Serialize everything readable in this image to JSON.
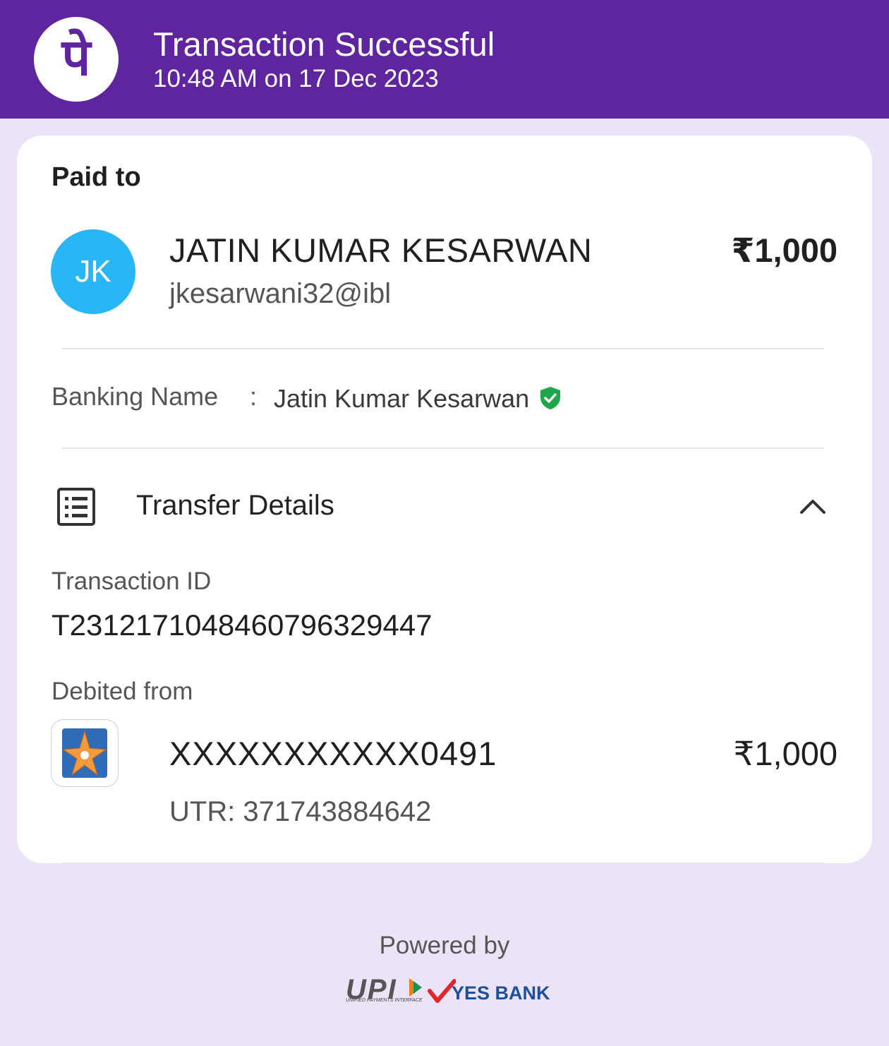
{
  "header": {
    "logo_glyph": "पे",
    "title": "Transaction Successful",
    "subtitle": "10:48 AM on 17 Dec 2023",
    "bg_color": "#5f259f"
  },
  "card": {
    "paid_to_label": "Paid to",
    "payee": {
      "initials": "JK",
      "name": "JATIN KUMAR KESARWAN",
      "upi_id": "jkesarwani32@ibl",
      "amount": "₹1,000",
      "avatar_color": "#29b6f6"
    },
    "banking_name": {
      "label": "Banking Name",
      "separator": ":",
      "value": "Jatin Kumar Kesarwan",
      "verified_icon": "verified-shield-icon",
      "verified_color": "#1fa64a"
    },
    "transfer_details": {
      "title": "Transfer Details",
      "icon": "receipt-list-icon",
      "toggle_icon": "chevron-up-icon",
      "transaction_id_label": "Transaction ID",
      "transaction_id": "T2312171048460796329447",
      "debited_from_label": "Debited from",
      "account": "XXXXXXXXXXX0491",
      "account_amount": "₹1,000",
      "utr": "UTR: 371743884642",
      "bank_icon": "bank-logo-icon"
    }
  },
  "footer": {
    "powered_by": "Powered by",
    "upi_logo_text": "UPI",
    "upi_logo_subtext": "UNIFIED PAYMENTS INTERFACE",
    "bank_logo_text": "YES BANK"
  }
}
